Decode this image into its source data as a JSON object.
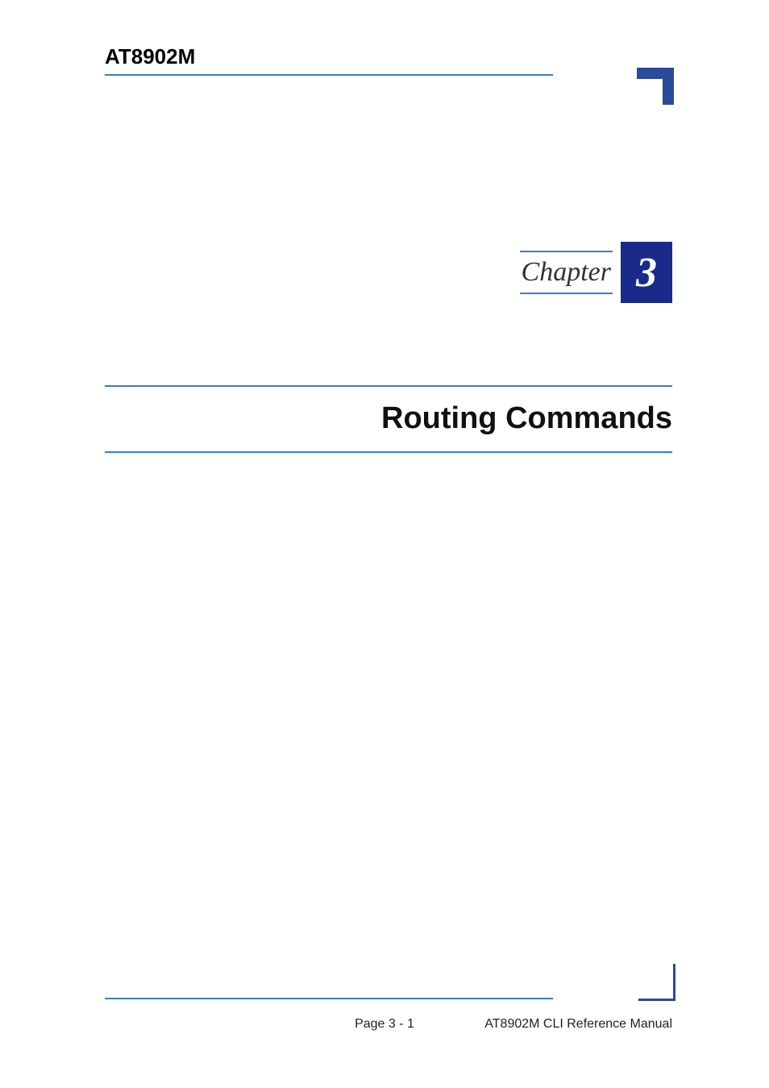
{
  "header": {
    "product": "AT8902M"
  },
  "chapter": {
    "label": "Chapter",
    "number": "3",
    "title": "Routing Commands"
  },
  "footer": {
    "page": "Page 3 - 1",
    "manual": "AT8902M CLI Reference Manual"
  }
}
